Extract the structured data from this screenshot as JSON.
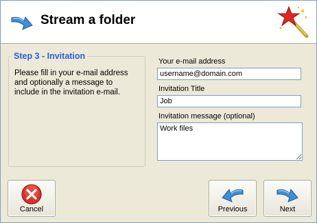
{
  "header": {
    "title": "Stream a folder"
  },
  "step": {
    "legend": "Step 3 - Invitation",
    "description": "Please fill in your e-mail address and optionally a message to include in the invitation e-mail."
  },
  "form": {
    "email_label": "Your e-mail address",
    "email_value": "username@domain.com",
    "title_label": "Invitation Title",
    "title_value": "Job",
    "message_label": "Invitation message (optional)",
    "message_value": "Work files"
  },
  "buttons": {
    "cancel": "Cancel",
    "previous": "Previous",
    "next": "Next"
  },
  "colors": {
    "accent": "#2a5ed9",
    "arrow": "#3d8fd6",
    "cancel": "#d8322a"
  }
}
